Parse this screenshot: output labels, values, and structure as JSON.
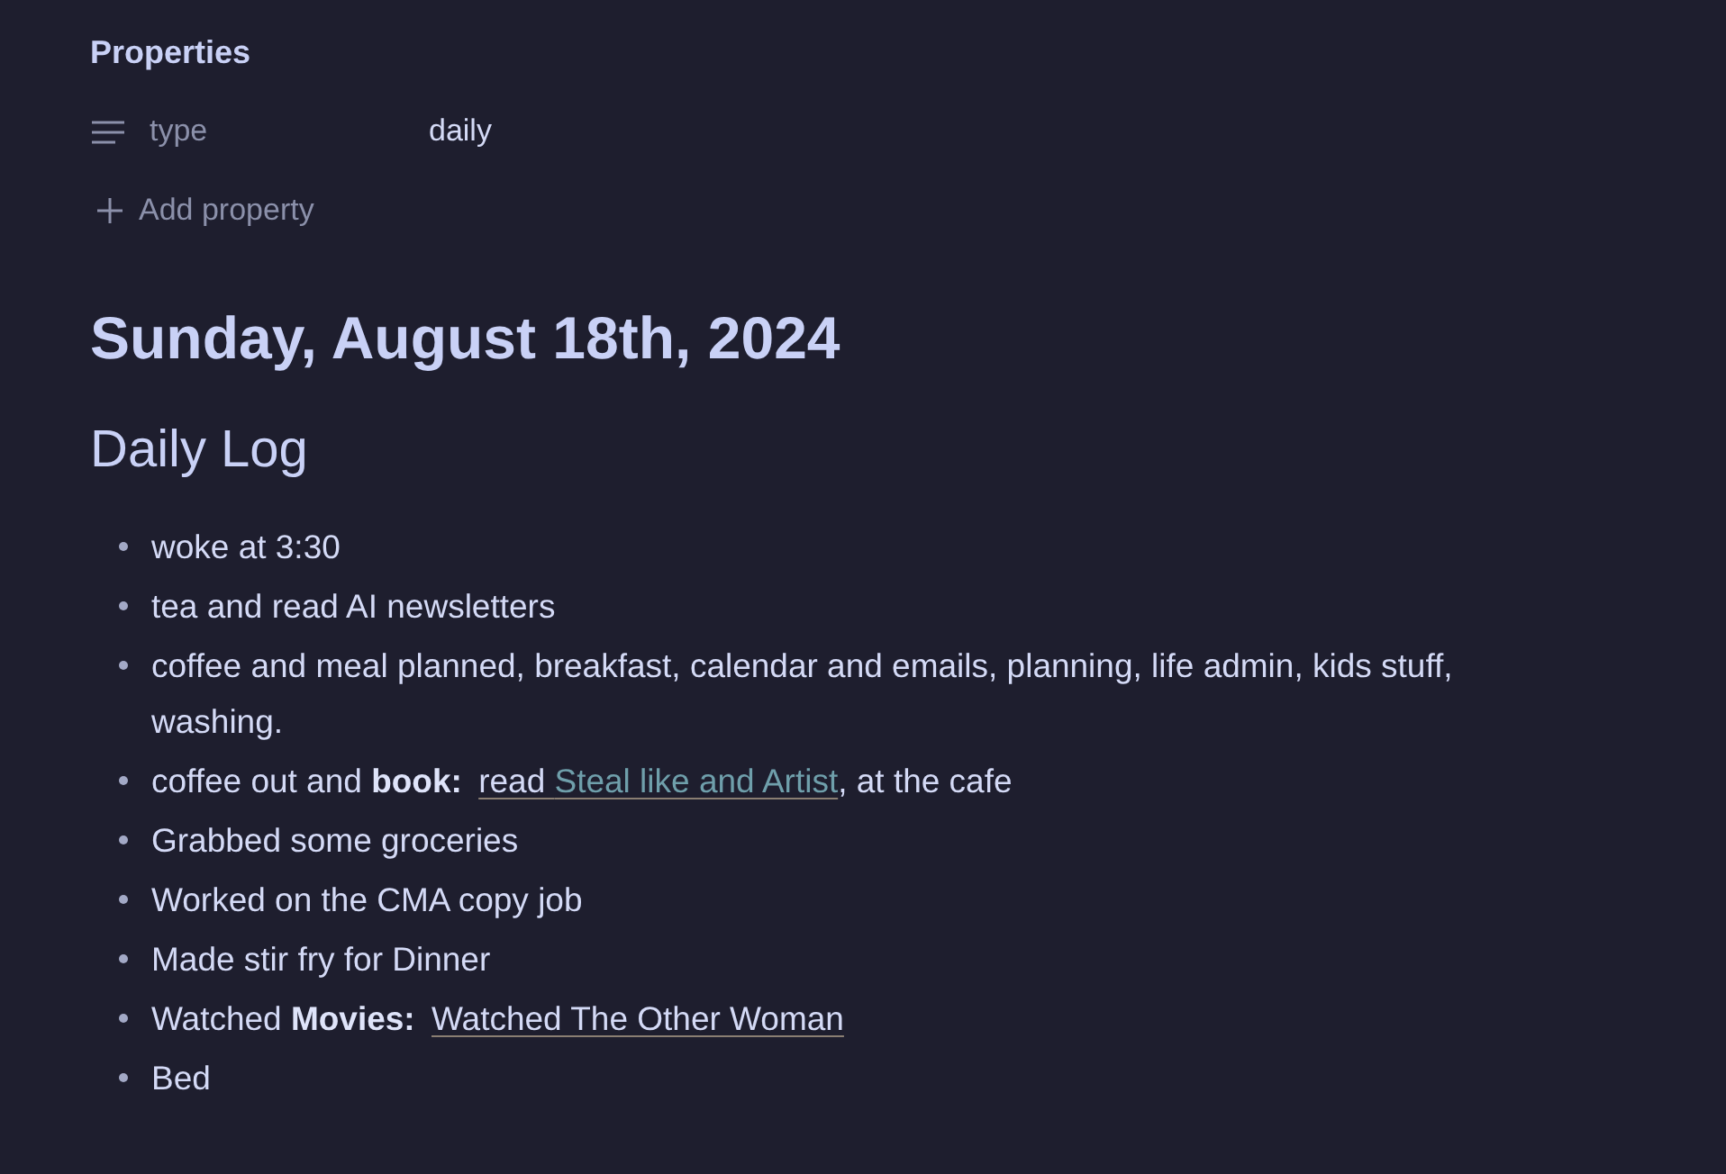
{
  "properties": {
    "title": "Properties",
    "items": [
      {
        "key": "type",
        "value": "daily"
      }
    ],
    "add_label": "Add property"
  },
  "title": "Sunday, August 18th, 2024",
  "sections": [
    {
      "heading": "Daily Log",
      "items": [
        {
          "text": "woke at 3:30"
        },
        {
          "text": "tea and read AI newsletters"
        },
        {
          "text": "coffee and meal planned, breakfast, calendar and emails, planning, life admin, kids stuff, washing."
        },
        {
          "text": "coffee out and **book:** ",
          "link": {
            "label": "read ",
            "title": "Steal like and Artist"
          },
          "after": ", at the cafe"
        },
        {
          "text": "Grabbed some groceries"
        },
        {
          "text": "Worked on the CMA copy job"
        },
        {
          "text": "Made stir fry for Dinner"
        },
        {
          "text": "Watched **Movies:** ",
          "link": {
            "label": "Watched The Other Woman"
          }
        },
        {
          "text": "Bed"
        }
      ]
    }
  ]
}
